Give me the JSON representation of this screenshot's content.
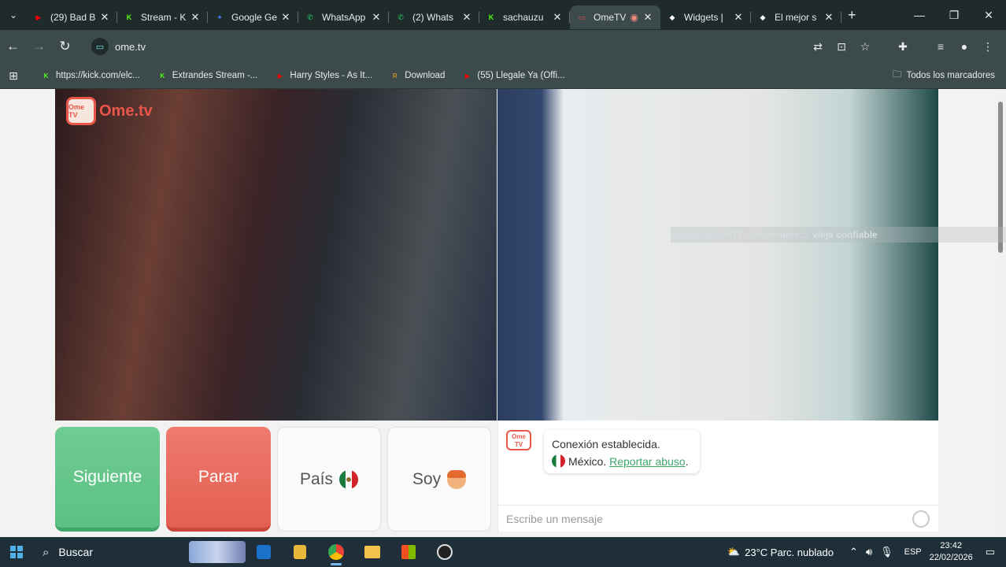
{
  "browser": {
    "tabs": [
      {
        "title": "(29) Bad B",
        "favicon_color": "#ff0000",
        "favicon_glyph": "▶"
      },
      {
        "title": "Stream - K",
        "favicon_color": "#53fc18",
        "favicon_glyph": "K"
      },
      {
        "title": "Google Ge",
        "favicon_color": "#4a7cf5",
        "favicon_glyph": "✦"
      },
      {
        "title": "WhatsApp",
        "favicon_color": "#25d366",
        "favicon_glyph": "✆"
      },
      {
        "title": "(2) Whats",
        "favicon_color": "#25d366",
        "favicon_glyph": "✆"
      },
      {
        "title": "sachauzu",
        "favicon_color": "#53fc18",
        "favicon_glyph": "K"
      },
      {
        "title": "OmeTV",
        "favicon_color": "#e8564a",
        "favicon_glyph": "▭",
        "active": true,
        "recording": true
      },
      {
        "title": "Widgets |",
        "favicon_color": "#ffffff",
        "favicon_glyph": "◆"
      },
      {
        "title": "El mejor s",
        "favicon_color": "#ffffff",
        "favicon_glyph": "◆"
      }
    ],
    "url": "ome.tv",
    "bookmarks": [
      {
        "label": "https://kick.com/elc...",
        "favicon_color": "#53fc18",
        "favicon_glyph": "K"
      },
      {
        "label": "Extrandes Stream -...",
        "favicon_color": "#53fc18",
        "favicon_glyph": "K"
      },
      {
        "label": "Harry Styles - As It...",
        "favicon_color": "#ff0000",
        "favicon_glyph": "▶"
      },
      {
        "label": "Download",
        "favicon_color": "#c98a2a",
        "favicon_glyph": "R"
      },
      {
        "label": "(55) Llegale Ya (Offi...",
        "favicon_color": "#ff0000",
        "favicon_glyph": "▶"
      }
    ],
    "all_bookmarks": "Todos los marcadores"
  },
  "ometv": {
    "logo_text": "Ome.tv",
    "logo_box": "Ome TV",
    "overlay_text": "DanielinaGodYT : !musculos ... vieja confiable",
    "buttons": {
      "next": "Siguiente",
      "stop": "Parar",
      "country": "País",
      "me": "Soy"
    },
    "chat": {
      "status": "Conexión establecida.",
      "country": "México.",
      "report": "Reportar abuso",
      "report_suffix": ".",
      "placeholder": "Escribe un mensaje"
    }
  },
  "taskbar": {
    "search_label": "Buscar",
    "weather": "23°C  Parc. nublado",
    "lang": "ESP",
    "time": "23:42",
    "date": "22/02/2026"
  }
}
